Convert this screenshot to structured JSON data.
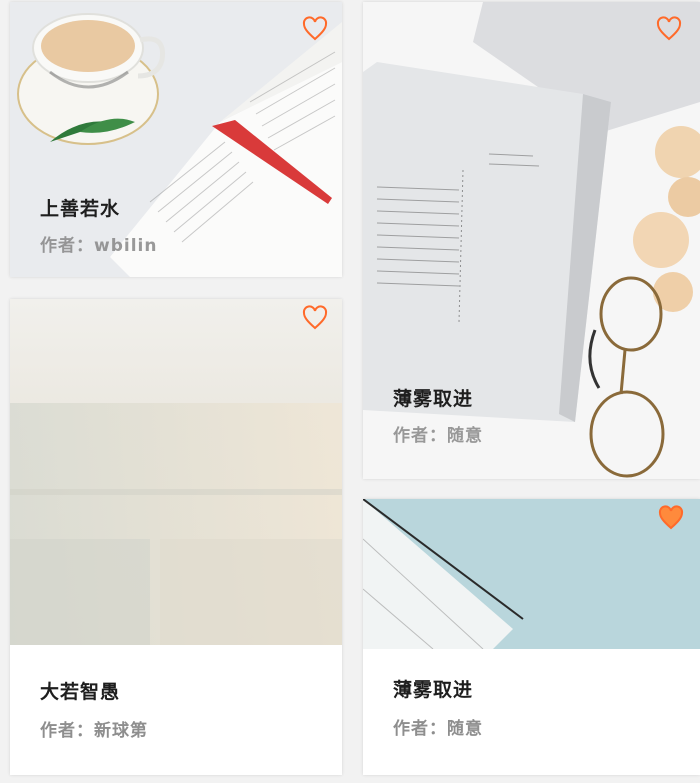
{
  "accent_color": "#ff6a2a",
  "cards": [
    {
      "title": "上善若水",
      "author": "作者：wbilin",
      "favorited": false
    },
    {
      "title": "薄雾取进",
      "author": "作者：随意",
      "favorited": false
    },
    {
      "title": "大若智愚",
      "author": "作者：新球第",
      "favorited": false
    },
    {
      "title": "薄雾取进",
      "author": "作者：随意",
      "favorited": true
    }
  ]
}
